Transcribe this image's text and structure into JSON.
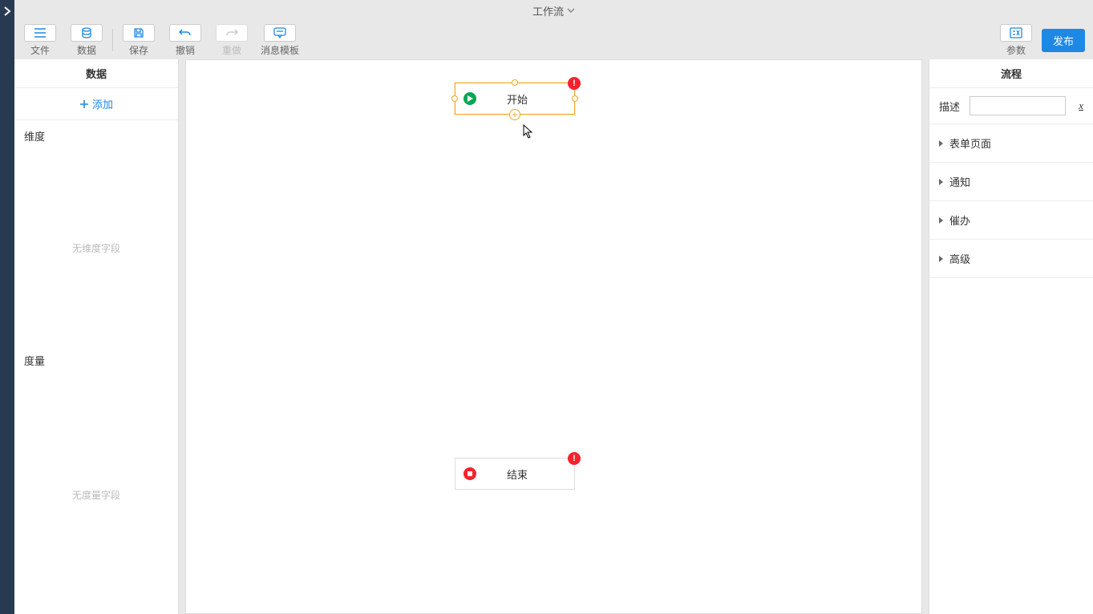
{
  "title": "工作流",
  "toolbar": {
    "file": "文件",
    "data": "数据",
    "save": "保存",
    "undo": "撤销",
    "redo": "重做",
    "message_template": "消息模板",
    "params": "参数",
    "publish": "发布"
  },
  "data_panel": {
    "title": "数据",
    "add": "添加",
    "dimension_label": "维度",
    "dimension_empty": "无维度字段",
    "measure_label": "度量",
    "measure_empty": "无度量字段"
  },
  "canvas": {
    "nodes": {
      "start": {
        "label": "开始"
      },
      "end": {
        "label": "结束"
      }
    }
  },
  "right_panel": {
    "title": "流程",
    "desc_label": "描述",
    "desc_value": "",
    "fx": "x",
    "sections": {
      "form_page": "表单页面",
      "notification": "通知",
      "reminder": "催办",
      "advanced": "高级"
    }
  }
}
